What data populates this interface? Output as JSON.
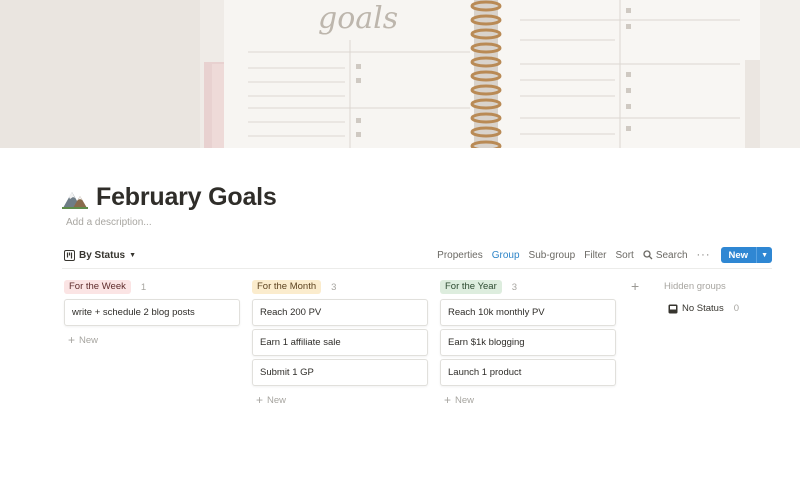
{
  "page": {
    "title": "February Goals",
    "description_placeholder": "Add a description..."
  },
  "cover": {
    "script_text": "goals"
  },
  "view": {
    "label": "By Status"
  },
  "toolbar": {
    "properties": "Properties",
    "group": "Group",
    "subgroup": "Sub-group",
    "filter": "Filter",
    "sort": "Sort",
    "search": "Search",
    "more": "···",
    "new": "New"
  },
  "groups": [
    {
      "label": "For the Week",
      "count": "1",
      "tag_bg": "#fbe4e4",
      "tag_color": "#5f2c2c",
      "cards": [
        "write + schedule 2 blog posts"
      ],
      "new_label": "New"
    },
    {
      "label": "For the Month",
      "count": "3",
      "tag_bg": "#fbeccd",
      "tag_color": "#5e4421",
      "cards": [
        "Reach 200 PV",
        "Earn 1 affiliate sale",
        "Submit 1 GP"
      ],
      "new_label": "New"
    },
    {
      "label": "For the Year",
      "count": "3",
      "tag_bg": "#ddedde",
      "tag_color": "#2c4a30",
      "cards": [
        "Reach 10k monthly PV",
        "Earn $1k blogging",
        "Launch 1 product"
      ],
      "new_label": "New"
    }
  ],
  "hidden": {
    "title": "Hidden groups",
    "items": [
      {
        "label": "No Status",
        "count": "0"
      }
    ]
  },
  "colors": {
    "accent": "#2f87d3",
    "active_toolbar": "#2e85c8"
  }
}
